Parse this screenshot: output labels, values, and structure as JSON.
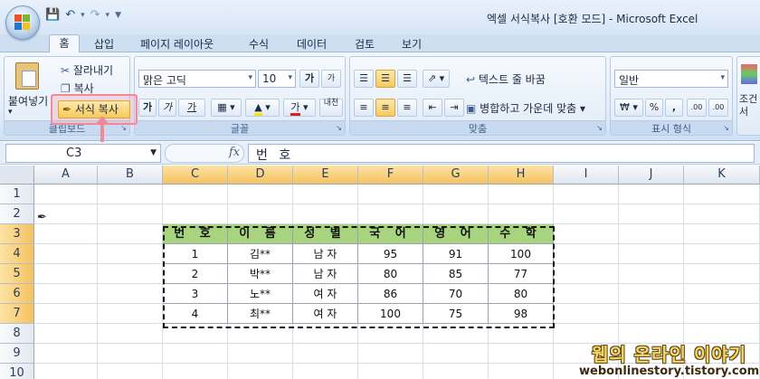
{
  "window": {
    "title": "엑셀 서식복사  [호환 모드] - Microsoft Excel",
    "qat": {
      "save_icon": "save-icon",
      "undo_icon": "undo-icon",
      "redo_icon": "redo-icon"
    }
  },
  "tabs": [
    "홈",
    "삽입",
    "페이지 레이아웃",
    "수식",
    "데이터",
    "검토",
    "보기"
  ],
  "ribbon": {
    "clipboard": {
      "paste_label": "붙여넣기",
      "cut_label": "잘라내기",
      "copy_label": "복사",
      "format_painter_label": "서식 복사",
      "group_label": "클립보드"
    },
    "font": {
      "font_name": "맑은 고딕",
      "font_size": "10",
      "grow_label": "가",
      "shrink_label": "가",
      "bold_label": "가",
      "italic_label": "가",
      "underline_label": "가",
      "color_label": "가",
      "phonetic_label": "내천",
      "group_label": "글꼴"
    },
    "alignment": {
      "wrap_text_label": "텍스트 줄 바꿈",
      "merge_label": "병합하고 가운데 맞춤",
      "group_label": "맞춤"
    },
    "number": {
      "format": "일반",
      "currency_label": "₩",
      "percent_label": "%",
      "comma_label": ",",
      "inc_decimal_label": ".00",
      "dec_decimal_label": ".00",
      "group_label": "표시 형식"
    },
    "styles_partial": "조건서"
  },
  "formula_bar": {
    "cell_ref": "C3",
    "fx": "fx",
    "value": "번 호"
  },
  "sheet": {
    "columns": [
      "A",
      "B",
      "C",
      "D",
      "E",
      "F",
      "G",
      "H",
      "I",
      "J",
      "K"
    ],
    "rows": [
      "1",
      "2",
      "3",
      "4",
      "5",
      "6",
      "7",
      "8",
      "9",
      "10"
    ],
    "table": {
      "headers": [
        "번 호",
        "이 름",
        "성 별",
        "국 어",
        "영 어",
        "수 학"
      ],
      "rows": [
        [
          "1",
          "김**",
          "남 자",
          "95",
          "91",
          "100"
        ],
        [
          "2",
          "박**",
          "남 자",
          "80",
          "85",
          "77"
        ],
        [
          "3",
          "노**",
          "여 자",
          "86",
          "70",
          "80"
        ],
        [
          "4",
          "최**",
          "여 자",
          "100",
          "75",
          "98"
        ]
      ]
    }
  },
  "watermark": {
    "line1": "웹의 온라인 이야기",
    "line2": "webonlinestory.tistory.com"
  },
  "colors": {
    "header_green": "#a9d47f",
    "highlight_pink": "#f08a9b",
    "selected_header": "#f5c261"
  }
}
